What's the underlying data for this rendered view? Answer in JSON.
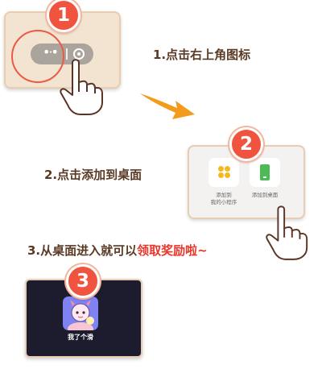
{
  "step1": {
    "badge": "1",
    "instruction": "1.点击右上角图标",
    "capsule": {
      "more_icon": "more-dots-icon",
      "close_icon": "target-circle-icon",
      "more_glyph": "•·•"
    }
  },
  "step2": {
    "badge": "2",
    "instruction": "2.点击添加到桌面",
    "options": [
      {
        "label": "添加到\n我的小程序",
        "icon": "add-to-my-miniprogram-icon"
      },
      {
        "label": "添加到桌面",
        "icon": "add-to-desktop-icon"
      }
    ]
  },
  "step3": {
    "badge": "3",
    "instruction_prefix": "3.从桌面进入就可以",
    "instruction_highlight": "领取奖励啦~",
    "app_label": "我了个滑"
  },
  "colors": {
    "badge_red": "#f0533e",
    "instruction_brown": "#5a3a24",
    "highlight_red": "#e8362a",
    "arrow_orange": "#f39b1c"
  }
}
